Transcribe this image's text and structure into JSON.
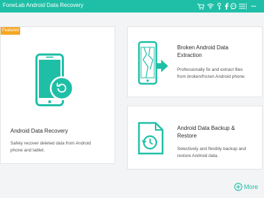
{
  "window": {
    "title": "FoneLab Android Data Recovery"
  },
  "titlebar": {
    "icons": [
      "cart-icon",
      "wifi-icon",
      "key-icon",
      "facebook-icon",
      "chat-icon",
      "menu-icon",
      "minimize-icon"
    ]
  },
  "cards": {
    "recovery": {
      "badge": "Featured",
      "title": "Android Data Recovery",
      "desc_line1": "Safely recover deleted data from Android",
      "desc_line2": "phone and tablet."
    },
    "broken": {
      "title_line1": "Broken Android Data",
      "title_line2": "Extraction",
      "desc_line1": "Professionally fix and extract files",
      "desc_line2": "from broken/frozen Android phone."
    },
    "backup": {
      "title_line1": "Android Data Backup &",
      "title_line2": "Restore",
      "desc_line1": "Selectively and flexibly backup and",
      "desc_line2": "restore Android data."
    }
  },
  "footer": {
    "more_label": "More"
  },
  "colors": {
    "accent": "#1fbfa7",
    "badge": "#f5a623",
    "background": "#f3f4f5"
  }
}
